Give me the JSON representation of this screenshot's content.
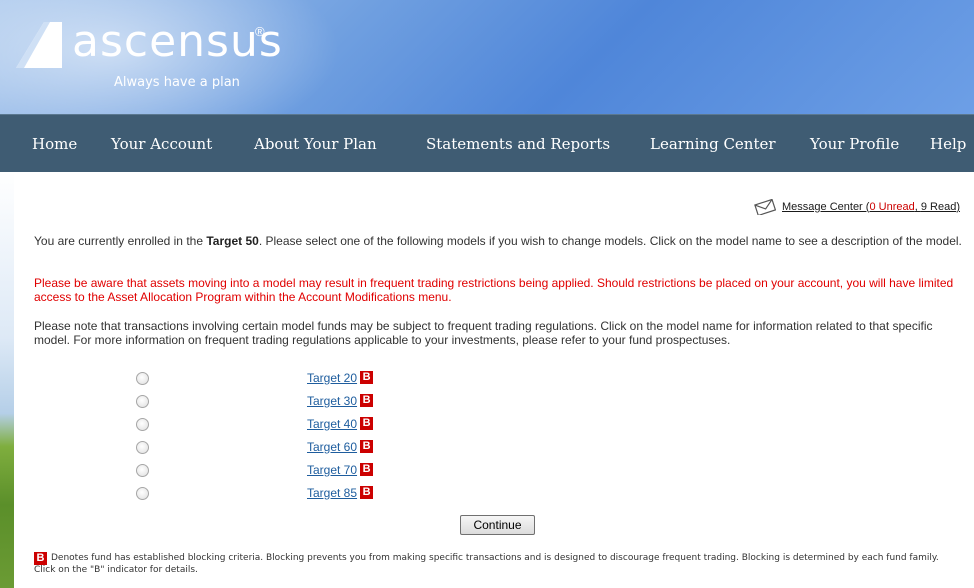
{
  "brand": {
    "name": "ascensus",
    "registered": "®",
    "tagline": "Always have a plan"
  },
  "nav": {
    "items": [
      {
        "label": "Home"
      },
      {
        "label": "Your Account"
      },
      {
        "label": "About Your Plan"
      },
      {
        "label": "Statements and Reports"
      },
      {
        "label": "Learning Center"
      },
      {
        "label": "Your Profile"
      },
      {
        "label": "Help"
      }
    ]
  },
  "message_center": {
    "icon": "envelope-icon",
    "label": "Message Center (",
    "unread": "0 Unread",
    "separator": ", ",
    "read": "9 Read",
    "close": ")"
  },
  "intro": {
    "before": "You are currently enrolled in the ",
    "current_model": "Target 50",
    "after": ". Please select one of the following models if you wish to change models. Click on the model name to see a description of the model."
  },
  "warning_text": "Please be aware that assets moving into a model may result in frequent trading restrictions being applied. Should restrictions be placed on your account, you will have limited access to the Asset Allocation Program within the Account Modifications menu.",
  "note_text": "Please note that transactions involving certain model funds may be subject to frequent trading regulations. Click on the model name for information related to that specific model. For more information on frequent trading regulations applicable to your investments, please refer to your fund prospectuses.",
  "models": [
    {
      "name": "Target 20",
      "badge": "B"
    },
    {
      "name": "Target 30",
      "badge": "B"
    },
    {
      "name": "Target 40",
      "badge": "B"
    },
    {
      "name": "Target 60",
      "badge": "B"
    },
    {
      "name": "Target 70",
      "badge": "B"
    },
    {
      "name": "Target 85",
      "badge": "B"
    }
  ],
  "continue_label": "Continue",
  "footnote": {
    "badge": "B",
    "text": "Denotes fund has established blocking criteria. Blocking prevents you from making specific transactions and is designed to discourage frequent trading. Blocking is determined by each fund family. Click on the \"B\" indicator for details."
  },
  "colors": {
    "nav_bg": "#3f5c73",
    "warning": "#e00000",
    "badge": "#cc0000",
    "link": "#1e5d9e"
  }
}
